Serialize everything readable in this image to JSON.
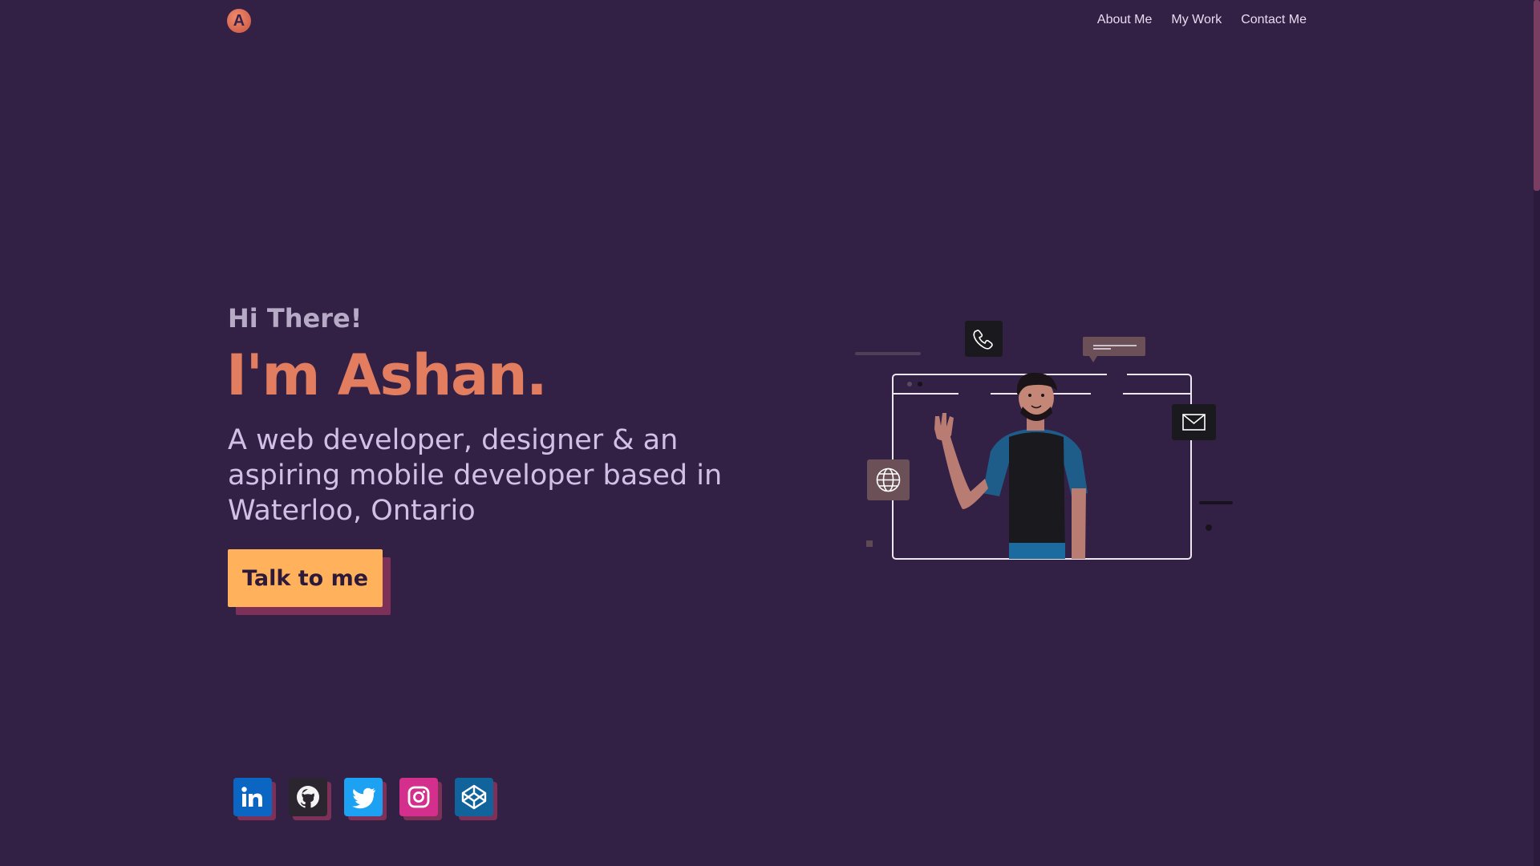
{
  "header": {
    "logo_letter": "A",
    "nav": [
      "About Me",
      "My Work",
      "Contact Me"
    ]
  },
  "hero": {
    "greeting": "Hi There!",
    "name": "I'm Ashan.",
    "tagline": "A web developer, designer & an aspiring mobile developer based in Waterloo, Ontario",
    "cta_label": "Talk to me"
  },
  "socials": [
    {
      "icon": "linkedin-icon",
      "color": "#0a66c2"
    },
    {
      "icon": "github-icon",
      "color": "#2b2530"
    },
    {
      "icon": "twitter-icon",
      "color": "#1da1f2"
    },
    {
      "icon": "instagram-icon",
      "color": "#d42f8c"
    },
    {
      "icon": "codepen-icon",
      "color": "#11639c"
    }
  ],
  "colors": {
    "background": "#332145",
    "accent": "#e27d5f",
    "button": "#ffb25b",
    "shadow": "#7d3158"
  }
}
